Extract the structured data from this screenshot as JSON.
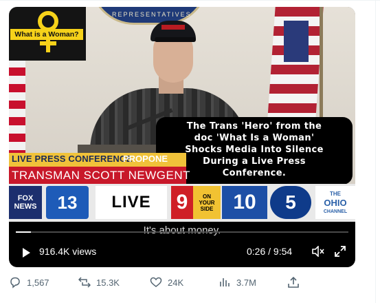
{
  "video": {
    "logo_text": "What is a Woman?",
    "seal_text": "REPRESENTATIVES",
    "caption_lines": [
      "The Trans 'Hero' from the",
      "doc 'What Is a Woman'",
      "Shocks Media Into Silence",
      "During a Live Press",
      "Conference."
    ],
    "lower_third_top": "LIVE PRESS CONFERENCE",
    "lower_third_top_extra": "PROPONE",
    "lower_third_bottom": "TRANSMAN SCOTT NEWGENT",
    "station_logos": {
      "fox": [
        "FOX",
        "NEWS"
      ],
      "ch13": "13",
      "live": "LIVE",
      "ch9": "9",
      "yourside": [
        "ON",
        "YOUR",
        "SIDE"
      ],
      "ch10": "10",
      "ch5": "5",
      "ohio": [
        "THE",
        "OHIO",
        "CHANNEL"
      ]
    },
    "subtitle": "It's about money.",
    "progress_fraction": 0.045,
    "views": "916.4K views",
    "time": "0:26 / 9:54"
  },
  "actions": {
    "replies": "1,567",
    "reposts": "15.3K",
    "likes": "24K",
    "views": "3.7M"
  },
  "icons": {
    "play": "play-icon",
    "volume": "volume-muted-icon",
    "fullscreen": "fullscreen-icon",
    "reply": "reply-icon",
    "repost": "repost-icon",
    "like": "heart-icon",
    "views": "analytics-icon",
    "share": "share-icon"
  }
}
